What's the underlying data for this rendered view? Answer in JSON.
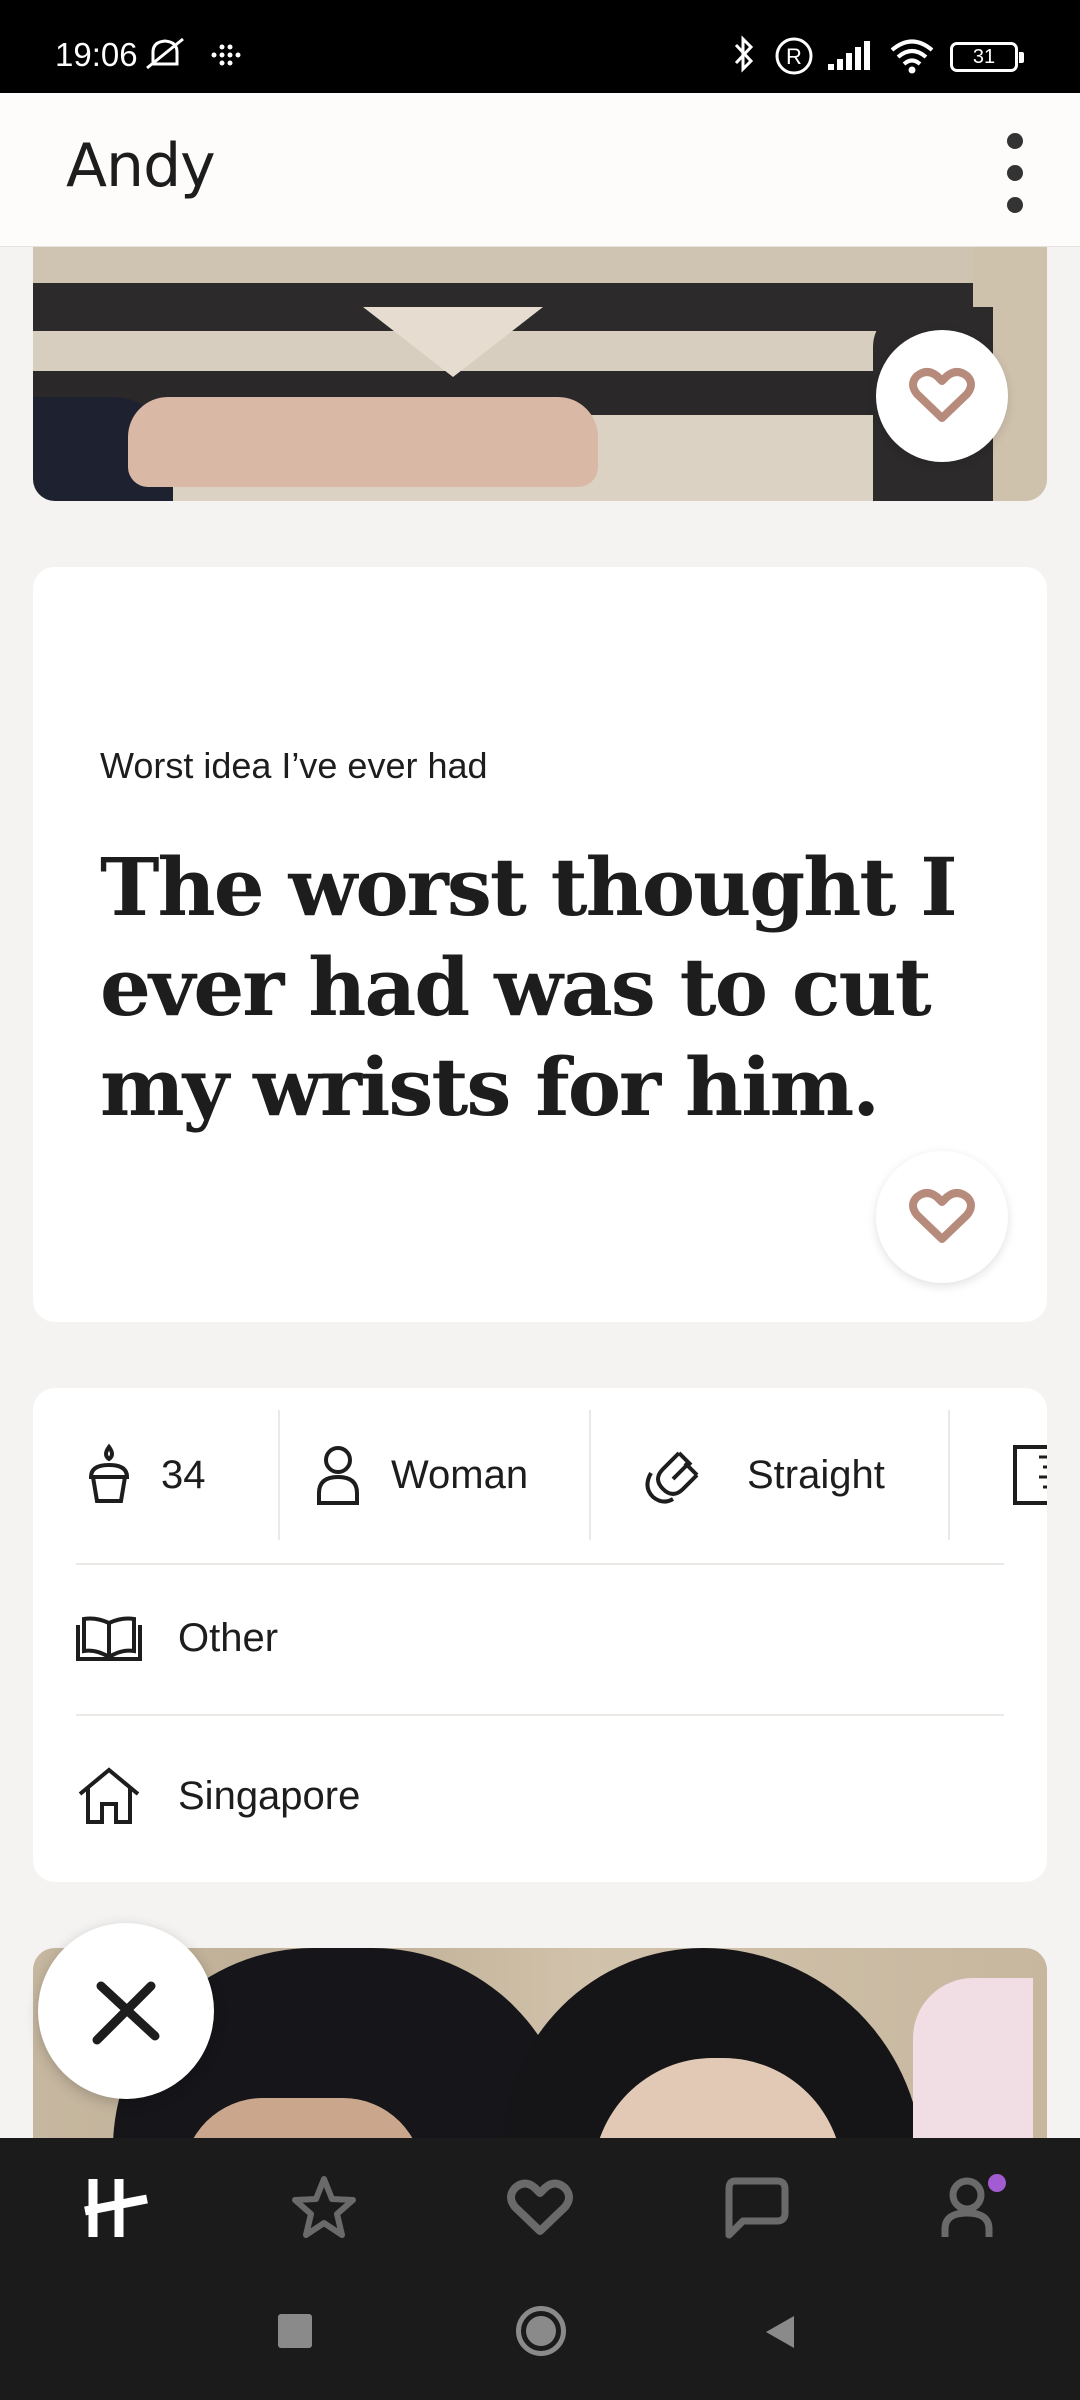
{
  "status_bar": {
    "time": "19:06",
    "battery": "31"
  },
  "header": {
    "title": "Andy"
  },
  "prompt": {
    "question": "Worst idea I’ve ever had",
    "answer": "The worst thought I ever had was to cut my wrists for him."
  },
  "info": {
    "age": "34",
    "gender": "Woman",
    "orientation": "Straight",
    "education": "Other",
    "location": "Singapore"
  },
  "colors": {
    "accent": "#b78b7c",
    "dark": "#1b1b1b",
    "notification_dot": "#a25bd0"
  },
  "icons": {
    "age": "cake-icon",
    "gender": "person-icon",
    "orientation": "magnet-icon",
    "height": "ruler-icon",
    "education": "book-icon",
    "location": "home-icon"
  }
}
